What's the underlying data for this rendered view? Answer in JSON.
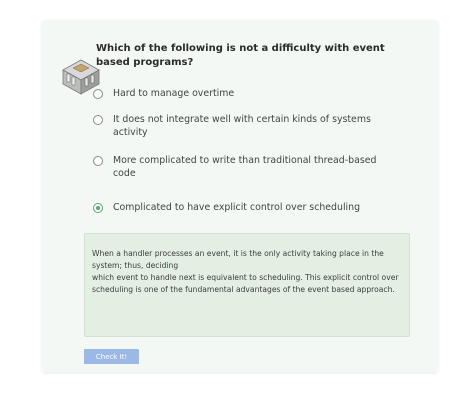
{
  "question": {
    "text": "Which of the following is not a difficulty with event based programs?"
  },
  "options": [
    {
      "label": "Hard to manage overtime",
      "selected": false
    },
    {
      "label": "It does not integrate well with certain kinds of systems activity",
      "selected": false
    },
    {
      "label": "More complicated to write than traditional thread-based code",
      "selected": false
    },
    {
      "label": "Complicated to have explicit control over scheduling",
      "selected": true
    }
  ],
  "explanation": {
    "lines": [
      "When a handler processes an event, it is the only activity taking place in the system; thus, deciding",
      "which event to handle next is equivalent to scheduling. This explicit control over scheduling is one of the fundamental advantages of the event based approach."
    ]
  },
  "check_button": {
    "label": "Check It!"
  },
  "colors": {
    "card_bg": "#f3f8f4",
    "explanation_bg": "#e3efe3",
    "selected_radio": "#5aa46d",
    "button_bg": "#9cb8e6"
  },
  "icons": {
    "avatar": "isometric-machine-avatar-icon"
  }
}
